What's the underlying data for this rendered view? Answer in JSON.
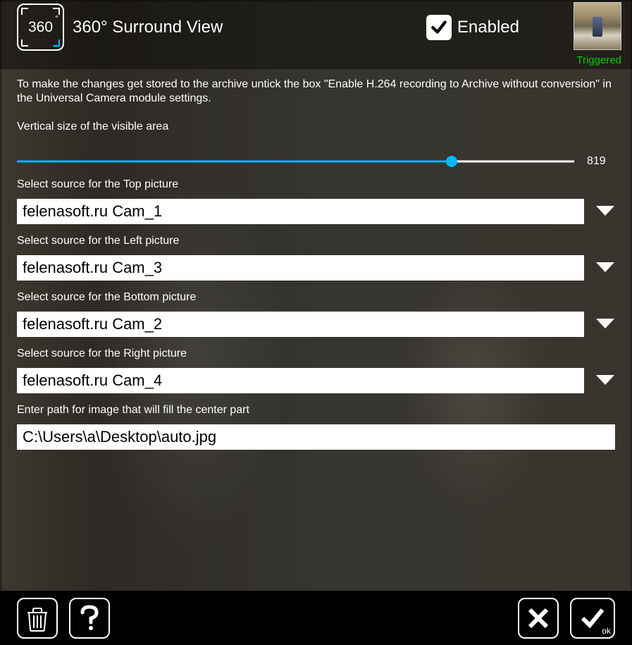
{
  "header": {
    "icon_text": "360",
    "icon_deg": "°",
    "title": "360° Surround View",
    "enabled_label": "Enabled",
    "enabled_checked": true,
    "status": "Triggered"
  },
  "content": {
    "help": "To make the changes get stored to the archive untick the box \"Enable H.264 recording to Archive without conversion\" in the Universal Camera module settings.",
    "vertical_label": "Vertical size of the visible area",
    "slider_value": "819",
    "slider_percent": 78,
    "sources": [
      {
        "label": "Select source for the Top picture",
        "value": "felenasoft.ru Cam_1"
      },
      {
        "label": "Select source for the Left picture",
        "value": "felenasoft.ru Cam_3"
      },
      {
        "label": "Select source for the Bottom picture",
        "value": "felenasoft.ru Cam_2"
      },
      {
        "label": "Select source for the Right picture",
        "value": "felenasoft.ru Cam_4"
      }
    ],
    "center_label": "Enter path for image that will fill the center part",
    "center_path": "C:\\Users\\a\\Desktop\\auto.jpg"
  },
  "footer": {
    "ok_label": "ok"
  }
}
